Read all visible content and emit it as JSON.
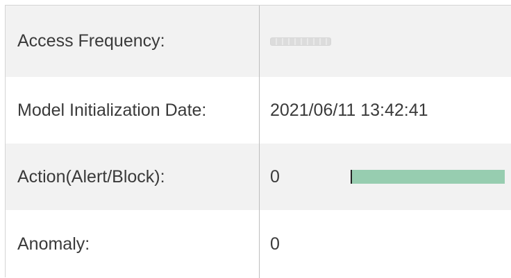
{
  "rows": [
    {
      "label": "Access Frequency:",
      "value": ""
    },
    {
      "label": "Model Initialization Date:",
      "value": "2021/06/11 13:42:41"
    },
    {
      "label": "Action(Alert/Block):",
      "value": "0"
    },
    {
      "label": "Anomaly:",
      "value": "0"
    }
  ],
  "action_bar": {
    "fill_fraction": 1.0,
    "fill_color": "#97cdb0",
    "marker_color": "#222222"
  },
  "colors": {
    "shaded_row": "#f2f2f2",
    "border": "#d4d4d4",
    "text": "#3a3a3a"
  }
}
